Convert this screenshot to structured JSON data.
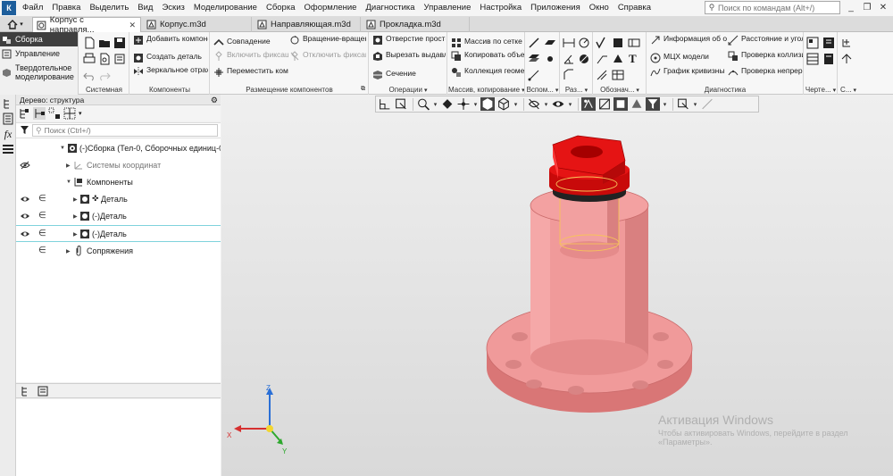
{
  "menubar": {
    "logo": "К",
    "items": [
      "Файл",
      "Правка",
      "Выделить",
      "Вид",
      "Эскиз",
      "Моделирование",
      "Сборка",
      "Оформление",
      "Диагностика",
      "Управление",
      "Настройка",
      "Приложения",
      "Окно",
      "Справка"
    ],
    "search_placeholder": "Поиск по командам (Alt+/)",
    "window_controls": [
      "_",
      "❐",
      "✕"
    ]
  },
  "tabs": [
    {
      "label": "Корпус с направля...",
      "active": true
    },
    {
      "label": "Корпус.m3d",
      "active": false
    },
    {
      "label": "Направляющая.m3d",
      "active": false
    },
    {
      "label": "Прокладка.m3d",
      "active": false
    }
  ],
  "ribbon": {
    "modes": [
      {
        "label": "Сборка",
        "active": true
      },
      {
        "label": "Управление",
        "active": false
      },
      {
        "label": "Твердотельное моделирование",
        "active": false
      }
    ],
    "groups": {
      "sistemnaya": "Системная",
      "komponenty": "Компоненты",
      "razmeshchenie": "Размещение компонентов",
      "operacii": "Операции",
      "massiv": "Массив, копирование",
      "vspom": "Вспом...",
      "raz": "Раз...",
      "oboznach": "Обознач...",
      "diagnostika": "Диагностика",
      "cherte": "Черте...",
      "s": "С..."
    },
    "buttons": {
      "add_component": "Добавить компонент из...",
      "create_part": "Создать деталь",
      "mirror": "Зеркальное отражение ко...",
      "coincide": "Совпадение",
      "rotate": "Вращение-вращение",
      "enable_fix": "Включить фиксацию",
      "disable_fix": "Отключить фиксацию",
      "move_component": "Переместить компонент",
      "hole": "Отверстие простое",
      "cut": "Вырезать выдавливанием",
      "section": "Сечение",
      "grid_array": "Массив по сетке",
      "copy_objects": "Копировать объекты",
      "geometry_collection": "Коллекция геометрии",
      "object_info": "Информация об объекте",
      "mcx": "МЦХ модели",
      "curvature": "График кривизны",
      "distance": "Расстояние и угол",
      "collisions": "Проверка коллизий",
      "continuity": "Проверка непрерывности"
    }
  },
  "tree": {
    "title": "Дерево: структура",
    "search_placeholder": "Поиск (Ctrl+/)",
    "rows": [
      {
        "label": "(-)Сборка (Тел-0, Сборочных единиц-0"
      },
      {
        "label": "Системы координат"
      },
      {
        "label": "Компоненты"
      },
      {
        "label": "Деталь"
      },
      {
        "label": "(-)Деталь"
      },
      {
        "label": "(-)Деталь"
      },
      {
        "label": "Сопряжения"
      }
    ]
  },
  "viewport": {
    "axes": {
      "x": "X",
      "y": "Y",
      "z": "Z"
    },
    "watermark_title": "Активация Windows",
    "watermark_sub": "Чтобы активировать Windows, перейдите в раздел «Параметры»."
  },
  "colors": {
    "model_body": "#f09a9a",
    "model_cap": "#e81010",
    "active_mode_bg": "#3f3f3f",
    "selection_line": "#7fd3dc"
  }
}
